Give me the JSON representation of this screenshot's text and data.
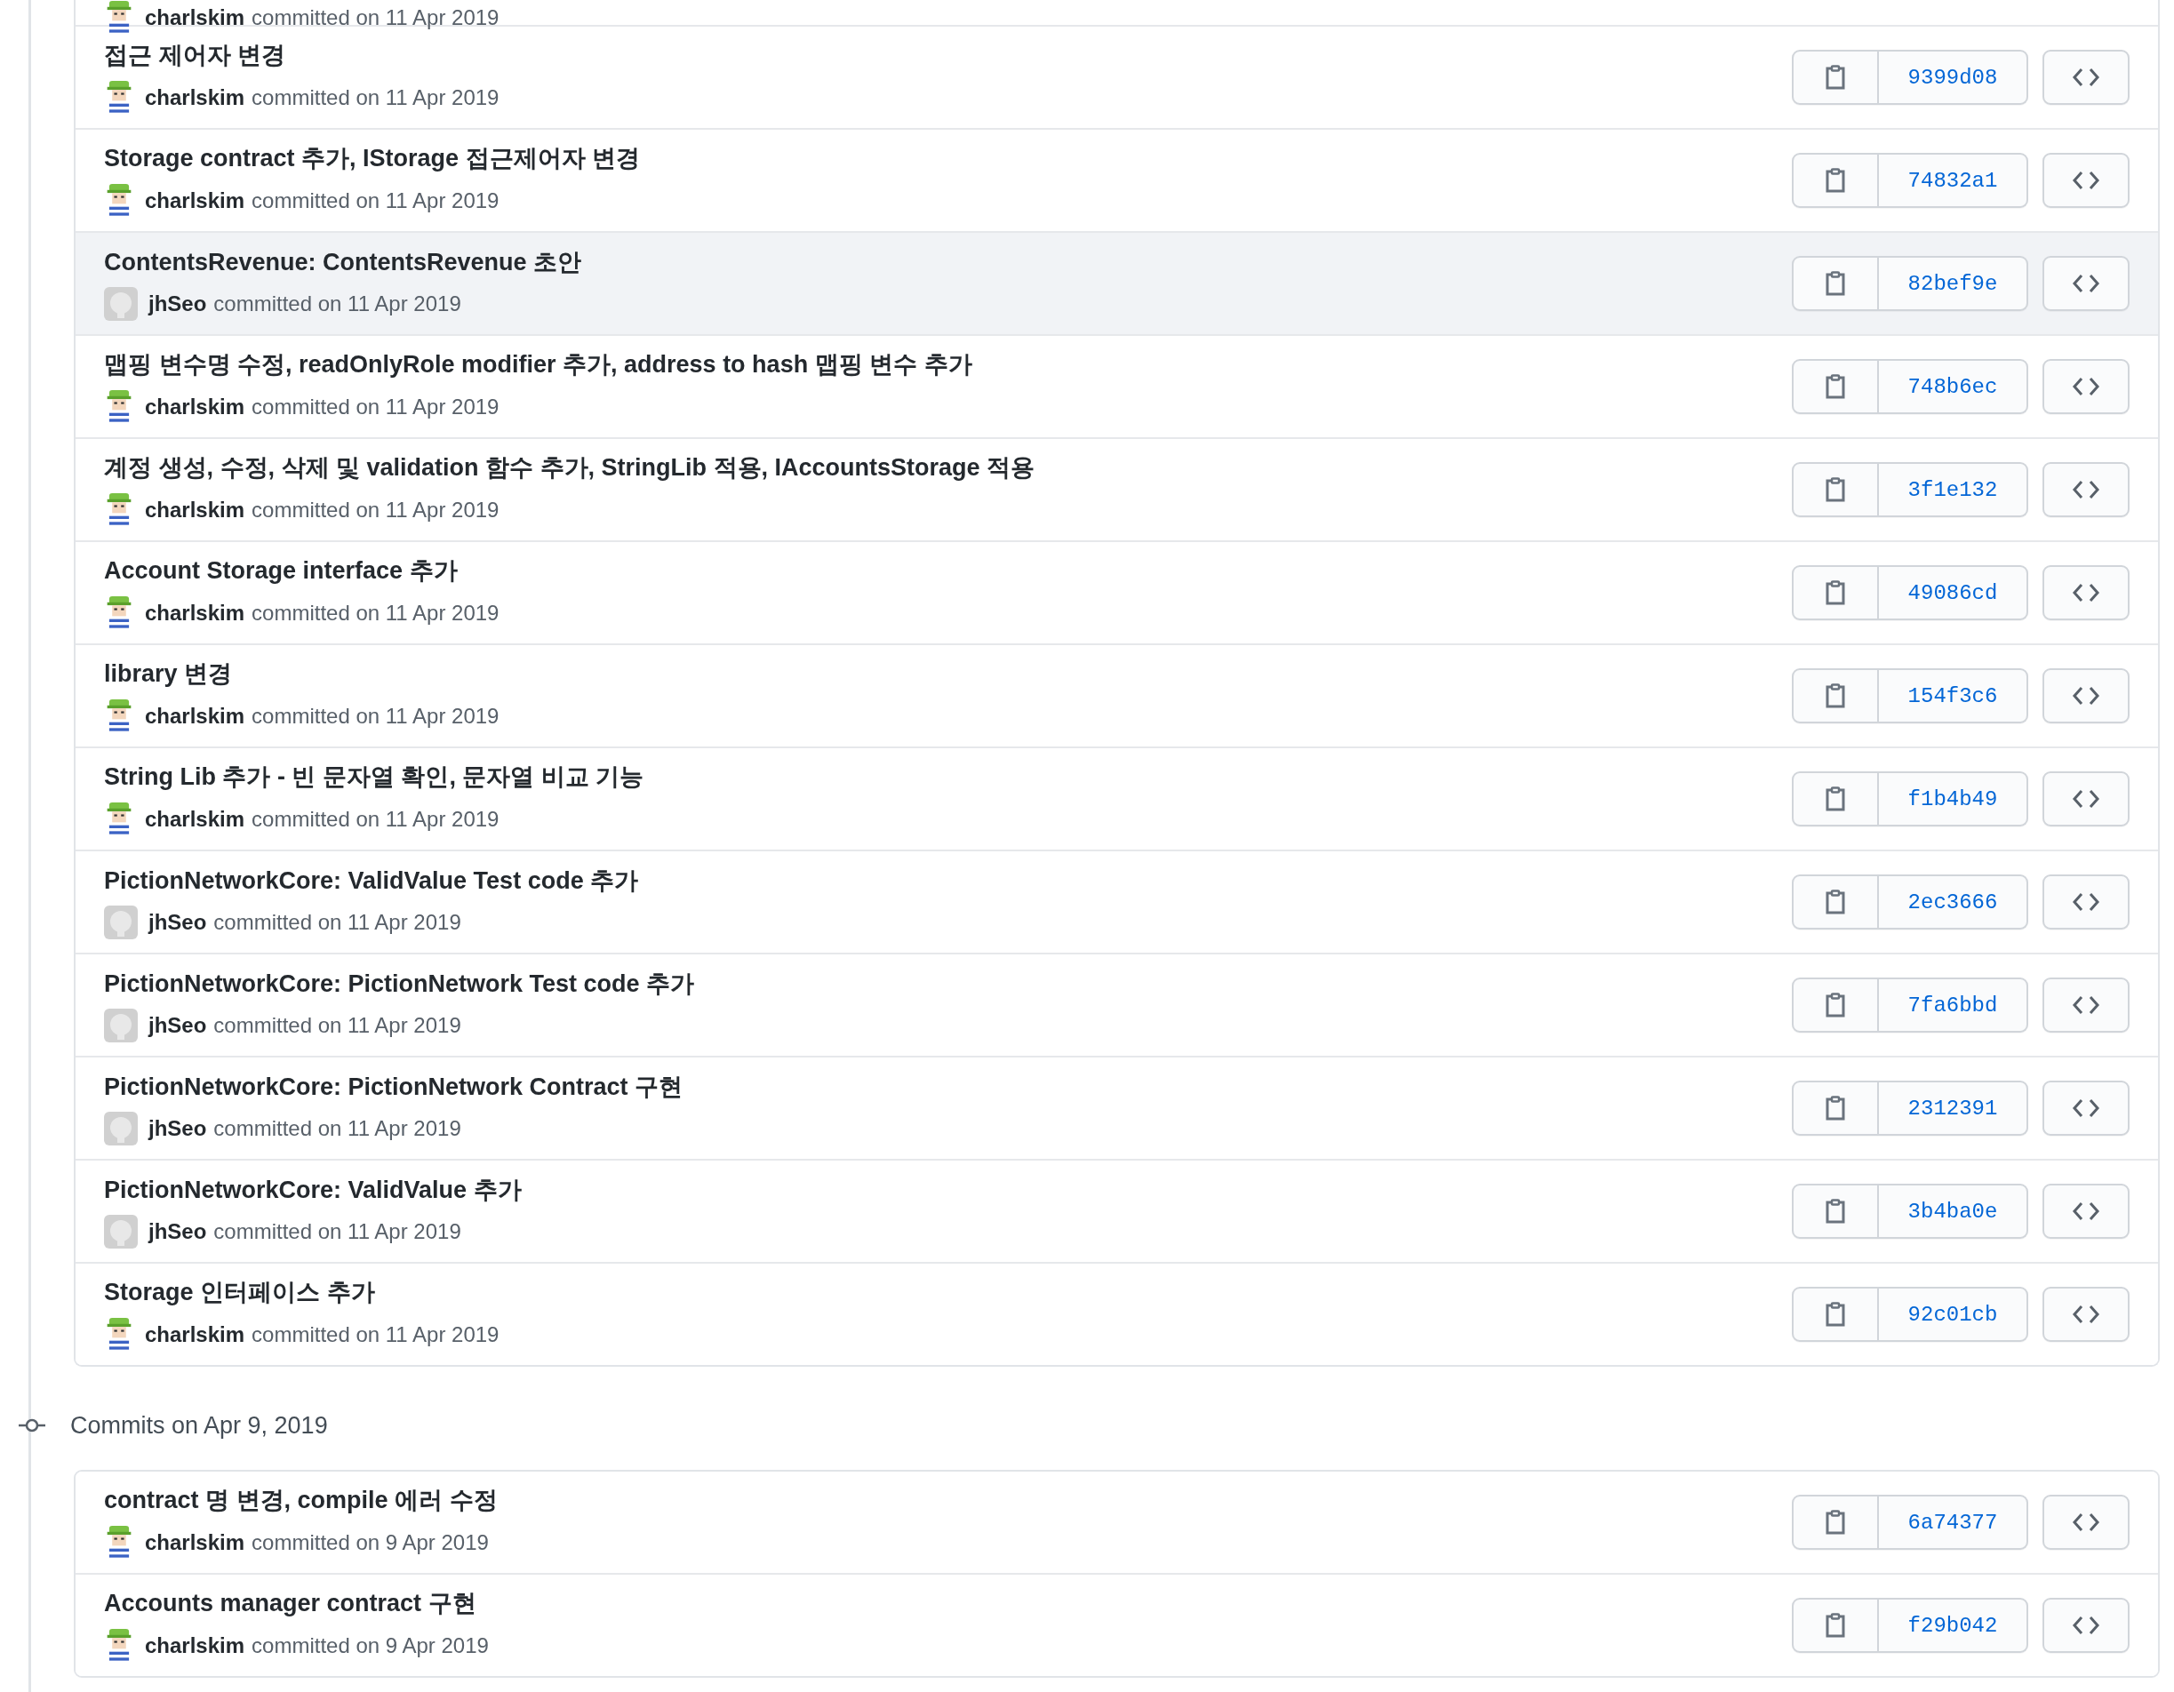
{
  "groups": [
    {
      "commits": [
        {
          "author": "charlskim",
          "kind": "character",
          "meta": "committed on 11 Apr 2019",
          "hovered": false
        },
        {
          "title": "접근 제어자 변경",
          "author": "charlskim",
          "kind": "character",
          "meta": "committed on 11 Apr 2019",
          "sha": "9399d08",
          "hovered": false
        },
        {
          "title": "Storage contract 추가, IStorage 접근제어자 변경",
          "author": "charlskim",
          "kind": "character",
          "meta": "committed on 11 Apr 2019",
          "sha": "74832a1",
          "hovered": false
        },
        {
          "title": "ContentsRevenue: ContentsRevenue 초안",
          "author": "jhSeo",
          "kind": "default",
          "meta": "committed on 11 Apr 2019",
          "sha": "82bef9e",
          "hovered": true
        },
        {
          "title": "맵핑 변수명 수정, readOnlyRole modifier 추가, address to hash 맵핑 변수 추가",
          "author": "charlskim",
          "kind": "character",
          "meta": "committed on 11 Apr 2019",
          "sha": "748b6ec",
          "hovered": false
        },
        {
          "title": "계정 생성, 수정, 삭제 및 validation 함수 추가, StringLib 적용, IAccountsStorage 적용",
          "author": "charlskim",
          "kind": "character",
          "meta": "committed on 11 Apr 2019",
          "sha": "3f1e132",
          "hovered": false
        },
        {
          "title": "Account Storage interface 추가",
          "author": "charlskim",
          "kind": "character",
          "meta": "committed on 11 Apr 2019",
          "sha": "49086cd",
          "hovered": false
        },
        {
          "title": "library 변경",
          "author": "charlskim",
          "kind": "character",
          "meta": "committed on 11 Apr 2019",
          "sha": "154f3c6",
          "hovered": false
        },
        {
          "title": "String Lib 추가 - 빈 문자열 확인, 문자열 비교 기능",
          "author": "charlskim",
          "kind": "character",
          "meta": "committed on 11 Apr 2019",
          "sha": "f1b4b49",
          "hovered": false
        },
        {
          "title": "PictionNetworkCore: ValidValue Test code 추가",
          "author": "jhSeo",
          "kind": "default",
          "meta": "committed on 11 Apr 2019",
          "sha": "2ec3666",
          "hovered": false
        },
        {
          "title": "PictionNetworkCore: PictionNetwork Test code 추가",
          "author": "jhSeo",
          "kind": "default",
          "meta": "committed on 11 Apr 2019",
          "sha": "7fa6bbd",
          "hovered": false
        },
        {
          "title": "PictionNetworkCore: PictionNetwork Contract 구현",
          "author": "jhSeo",
          "kind": "default",
          "meta": "committed on 11 Apr 2019",
          "sha": "2312391",
          "hovered": false
        },
        {
          "title": "PictionNetworkCore: ValidValue 추가",
          "author": "jhSeo",
          "kind": "default",
          "meta": "committed on 11 Apr 2019",
          "sha": "3b4ba0e",
          "hovered": false
        },
        {
          "title": "Storage 인터페이스 추가",
          "author": "charlskim",
          "kind": "character",
          "meta": "committed on 11 Apr 2019",
          "sha": "92c01cb",
          "hovered": false
        }
      ]
    },
    {
      "title": "Commits on Apr 9, 2019",
      "commits": [
        {
          "title": "contract 명 변경, compile 에러 수정",
          "author": "charlskim",
          "kind": "character",
          "meta": "committed on 9 Apr 2019",
          "sha": "6a74377",
          "hovered": false
        },
        {
          "title": "Accounts manager contract 구현",
          "author": "charlskim",
          "kind": "character",
          "meta": "committed on 9 Apr 2019",
          "sha": "f29b042",
          "hovered": false
        }
      ]
    }
  ]
}
